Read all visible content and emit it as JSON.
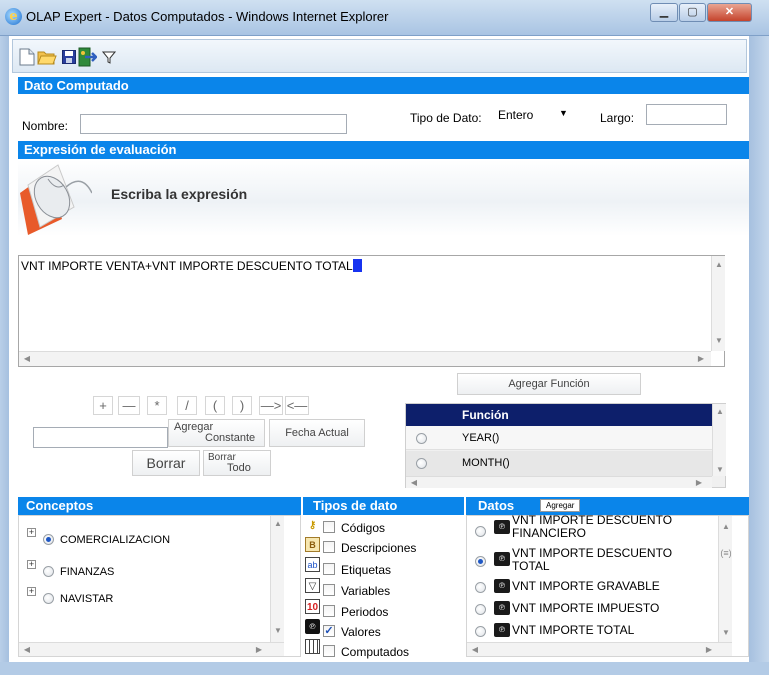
{
  "window": {
    "title": "OLAP Expert - Datos Computados - Windows Internet Explorer"
  },
  "toolbar": {
    "icons": [
      "new-document-icon",
      "open-folder-icon",
      "save-icon",
      "exit-icon",
      "filter-icon"
    ]
  },
  "dato_computado": {
    "header": "Dato Computado",
    "nombre_label": "Nombre:",
    "nombre_value": "",
    "tipo_label": "Tipo de Dato:",
    "tipo_value": "Entero",
    "largo_label": "Largo:",
    "largo_value": ""
  },
  "expresion": {
    "header": "Expresión de evaluación",
    "banner_text": "Escriba la expresión",
    "text": "VNT IMPORTE VENTA+VNT IMPORTE DESCUENTO TOTAL"
  },
  "operators": [
    "+",
    "—",
    "*",
    "/",
    "(",
    ")",
    "—>",
    "<—"
  ],
  "buttons": {
    "agregar_funcion": "Agregar  Función",
    "agregar_constante_1": "Agregar",
    "agregar_constante_2": "Constante",
    "fecha_actual": "Fecha  Actual",
    "borrar": "Borrar",
    "borrar_todo_1": "Borrar",
    "borrar_todo_2": "Todo",
    "agregar_datos": "Agregar"
  },
  "constante_value": "",
  "funcion": {
    "header": "Función",
    "rows": [
      "YEAR()",
      "MONTH()"
    ]
  },
  "conceptos": {
    "header": "Conceptos",
    "items": [
      {
        "label": "COMERCIALIZACION",
        "selected": true
      },
      {
        "label": "FINANZAS",
        "selected": false
      },
      {
        "label": "NAVISTAR",
        "selected": false
      }
    ]
  },
  "tipos": {
    "header": "Tipos de dato",
    "items": [
      {
        "label": "Códigos",
        "checked": false,
        "icon": "key-icon"
      },
      {
        "label": "Descripciones",
        "checked": false,
        "icon": "descriptions-icon"
      },
      {
        "label": "Etiquetas",
        "checked": false,
        "icon": "label-icon"
      },
      {
        "label": "Variables",
        "checked": false,
        "icon": "funnel-icon"
      },
      {
        "label": "Periodos",
        "checked": false,
        "icon": "calendar-icon"
      },
      {
        "label": "Valores",
        "checked": true,
        "icon": "values-icon"
      },
      {
        "label": "Computados",
        "checked": false,
        "icon": "calculator-icon"
      }
    ]
  },
  "datos": {
    "header": "Datos",
    "items": [
      {
        "line1": "VNT IMPORTE DESCUENTO",
        "line2": "FINANCIERO",
        "selected": false
      },
      {
        "line1": "VNT IMPORTE DESCUENTO",
        "line2": "TOTAL",
        "selected": true
      },
      {
        "line1": "VNT IMPORTE GRAVABLE",
        "line2": "",
        "selected": false
      },
      {
        "line1": "VNT IMPORTE IMPUESTO",
        "line2": "",
        "selected": false
      },
      {
        "line1": "VNT IMPORTE TOTAL",
        "line2": "",
        "selected": false
      }
    ]
  },
  "colors": {
    "header_blue": "#0a85ea",
    "caret_blue": "#1733f0"
  }
}
